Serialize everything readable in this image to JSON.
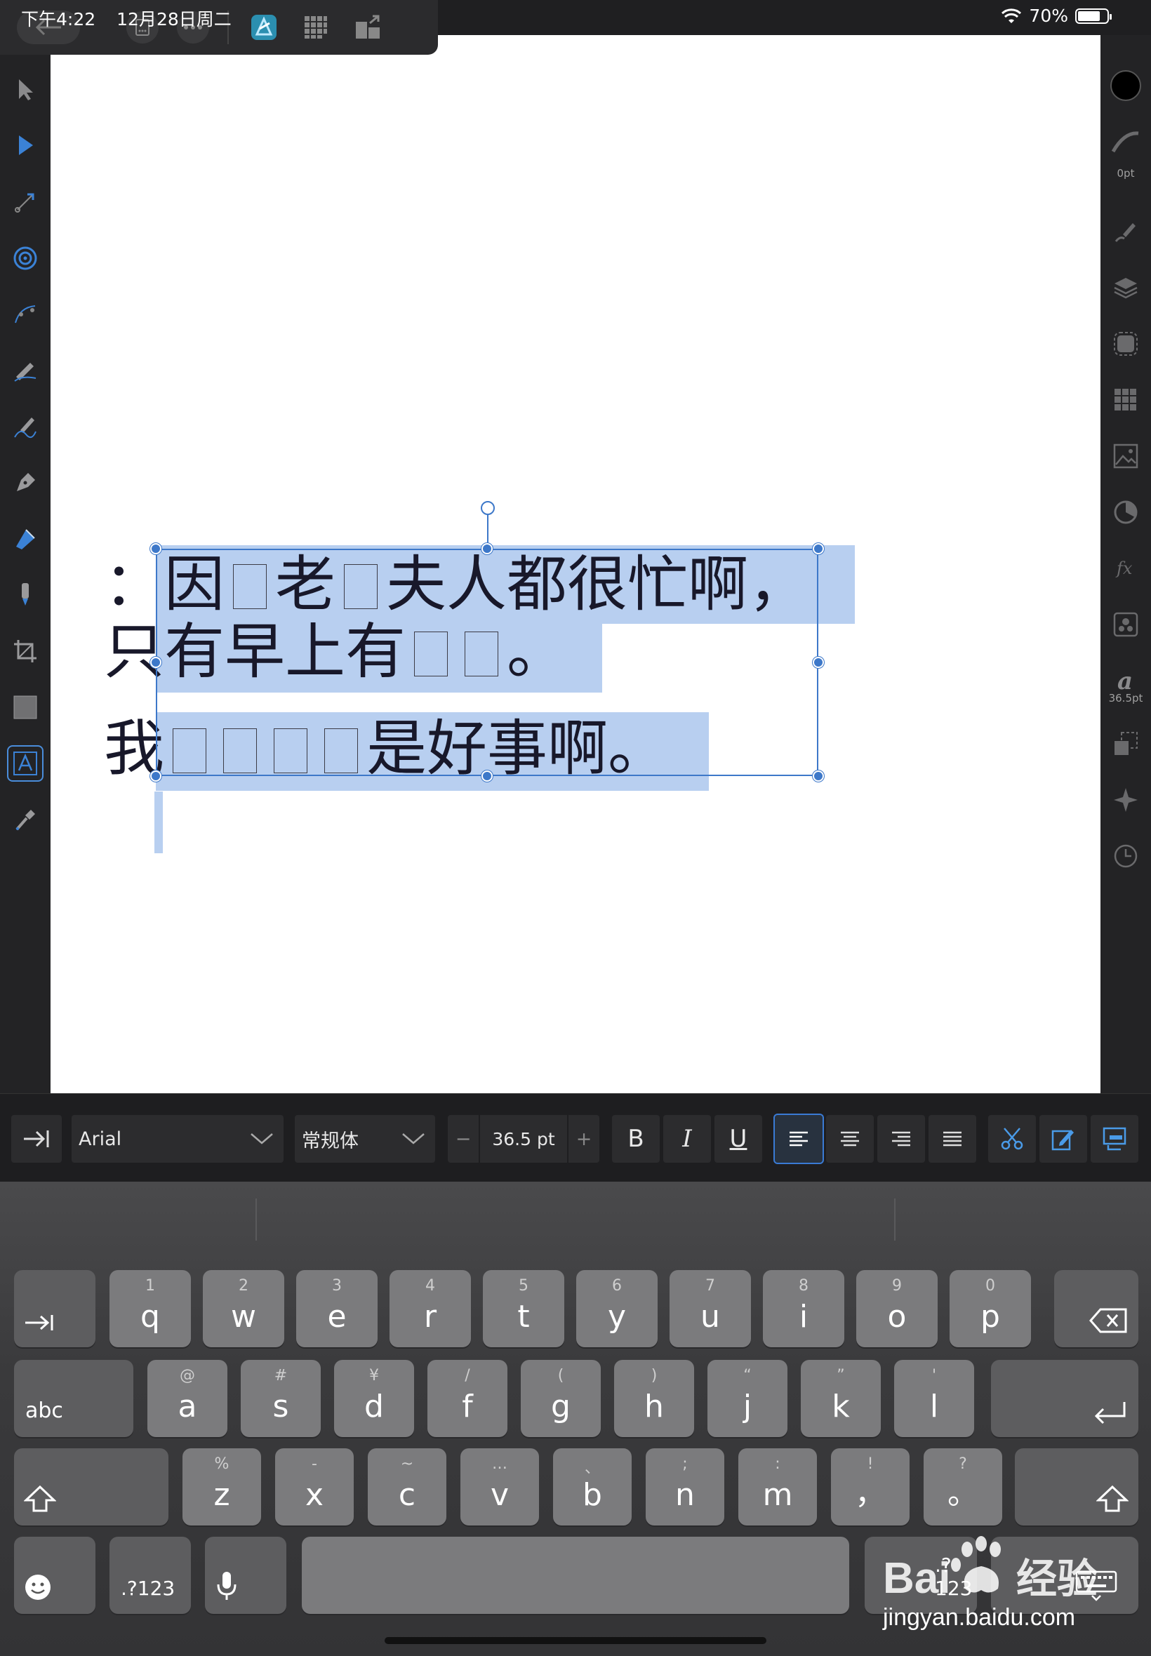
{
  "status": {
    "time": "下午4:22",
    "date": "12月28日周二",
    "battery": "70%"
  },
  "canvas": {
    "line1": [
      "：因",
      "老",
      "夫人都很忙啊，"
    ],
    "line2": [
      "只有早上有",
      "。"
    ],
    "line3": [
      "我",
      "是好事啊。"
    ]
  },
  "panel": {
    "stroke_width": "0pt",
    "font_size_label": "36.5pt"
  },
  "format_bar": {
    "font_family": "Arial",
    "font_style": "常规体",
    "font_size": "36.5 pt",
    "minus": "−",
    "plus": "+",
    "bold": "B",
    "italic": "I",
    "underline": "U"
  },
  "keyboard": {
    "row1": [
      {
        "main": "q",
        "sub": "1"
      },
      {
        "main": "w",
        "sub": "2"
      },
      {
        "main": "e",
        "sub": "3"
      },
      {
        "main": "r",
        "sub": "4"
      },
      {
        "main": "t",
        "sub": "5"
      },
      {
        "main": "y",
        "sub": "6"
      },
      {
        "main": "u",
        "sub": "7"
      },
      {
        "main": "i",
        "sub": "8"
      },
      {
        "main": "o",
        "sub": "9"
      },
      {
        "main": "p",
        "sub": "0"
      }
    ],
    "row2": [
      {
        "main": "a",
        "sub": "@"
      },
      {
        "main": "s",
        "sub": "#"
      },
      {
        "main": "d",
        "sub": "¥"
      },
      {
        "main": "f",
        "sub": "/"
      },
      {
        "main": "g",
        "sub": "("
      },
      {
        "main": "h",
        "sub": ")"
      },
      {
        "main": "j",
        "sub": "“"
      },
      {
        "main": "k",
        "sub": "”"
      },
      {
        "main": "l",
        "sub": "'"
      }
    ],
    "row3": [
      {
        "main": "z",
        "sub": "%"
      },
      {
        "main": "x",
        "sub": "-"
      },
      {
        "main": "c",
        "sub": "~"
      },
      {
        "main": "v",
        "sub": "…"
      },
      {
        "main": "b",
        "sub": "、"
      },
      {
        "main": "n",
        "sub": ";"
      },
      {
        "main": "m",
        "sub": ":"
      },
      {
        "main": "，",
        "sub": "!"
      },
      {
        "main": "。",
        "sub": "?"
      }
    ],
    "abc": "abc",
    "num_left": ".?123",
    "num_right": ".?123"
  },
  "watermark": {
    "brand": "Bai 经验",
    "url": "jingyan.baidu.com"
  }
}
